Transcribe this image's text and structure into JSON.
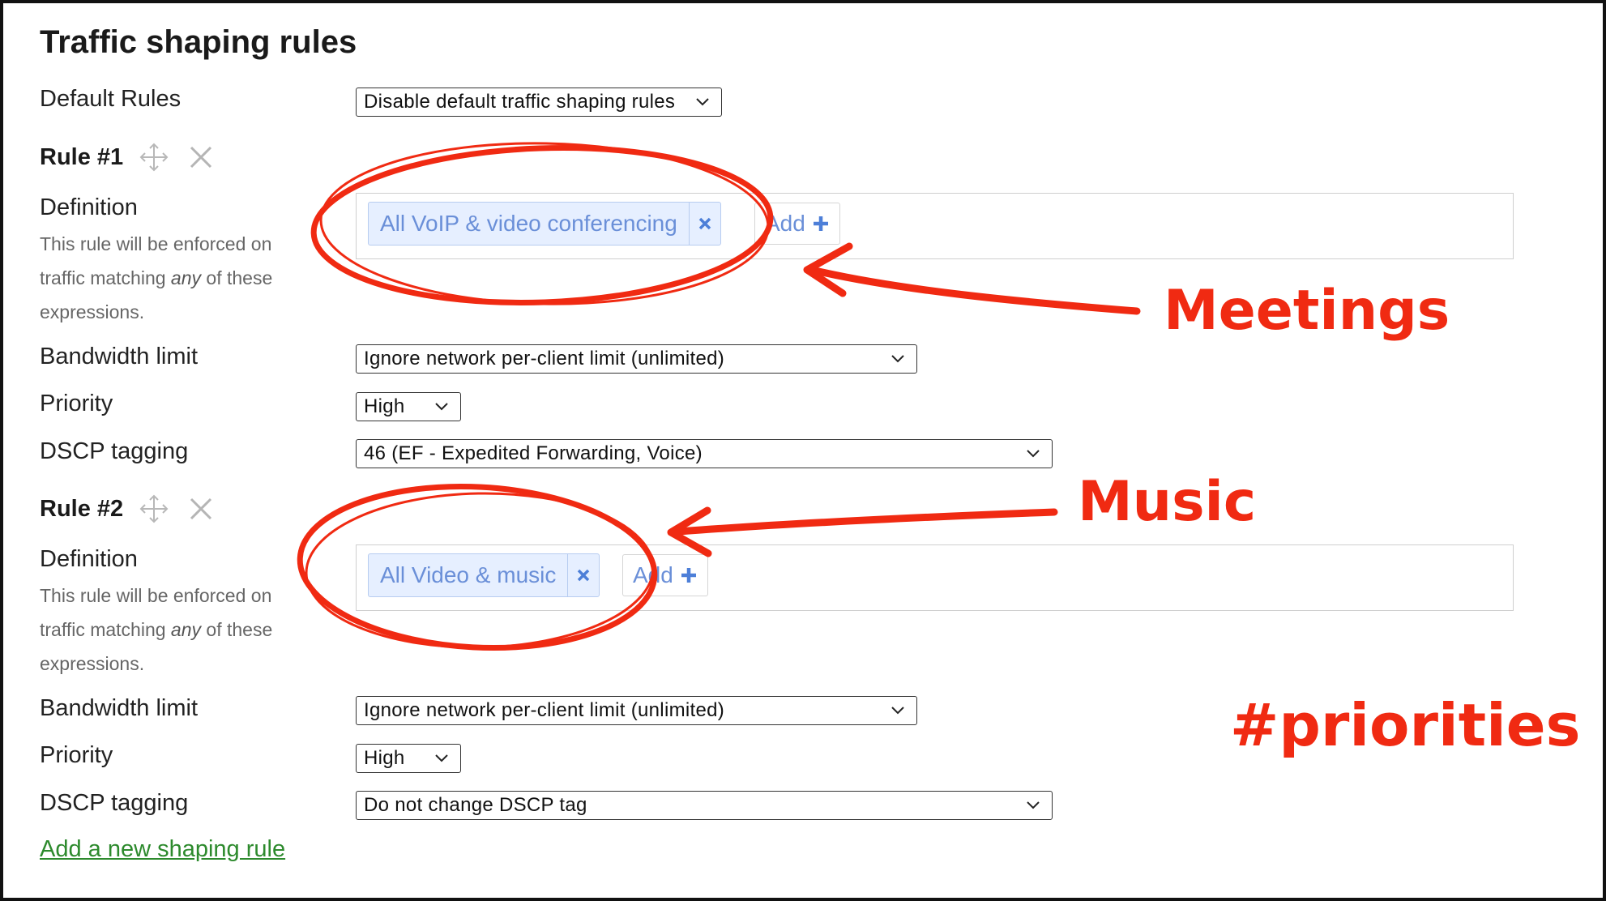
{
  "page": {
    "title": "Traffic shaping rules"
  },
  "default_rules": {
    "label": "Default Rules",
    "selected": "Disable default traffic shaping rules"
  },
  "rules": [
    {
      "title": "Rule #1",
      "definition_label": "Definition",
      "definition_help_1": "This rule will be enforced on traffic matching ",
      "definition_help_em": "any",
      "definition_help_2": " of these expressions.",
      "tag": "All VoIP & video conferencing",
      "add_label": "Add",
      "bandwidth_label": "Bandwidth limit",
      "bandwidth_value": "Ignore network per-client limit (unlimited)",
      "priority_label": "Priority",
      "priority_value": "High",
      "dscp_label": "DSCP tagging",
      "dscp_value": "46 (EF - Expedited Forwarding, Voice)"
    },
    {
      "title": "Rule #2",
      "definition_label": "Definition",
      "definition_help_1": "This rule will be enforced on traffic matching ",
      "definition_help_em": "any",
      "definition_help_2": " of these expressions.",
      "tag": "All Video & music",
      "add_label": "Add",
      "bandwidth_label": "Bandwidth limit",
      "bandwidth_value": "Ignore network per-client limit (unlimited)",
      "priority_label": "Priority",
      "priority_value": "High",
      "dscp_label": "DSCP tagging",
      "dscp_value": "Do not change DSCP tag"
    }
  ],
  "add_rule_link": "Add a new shaping rule",
  "annotations": {
    "meetings": "Meetings",
    "music": "Music",
    "hashtag": "#priorities",
    "color": "#f02a12"
  },
  "colors": {
    "tag_text": "#6a8fd8",
    "tag_bg": "#e6efff",
    "link": "#2d8a2d"
  },
  "icons": [
    "move-icon",
    "delete-icon",
    "chevron-down-icon",
    "remove-tag-icon",
    "plus-icon"
  ]
}
